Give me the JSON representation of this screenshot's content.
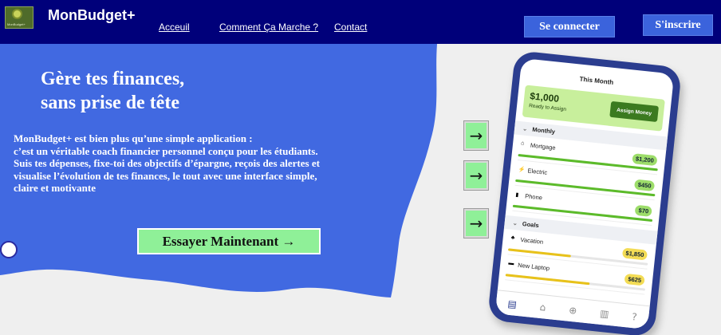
{
  "header": {
    "logo_text": "MonBudget+",
    "brand": "MonBudget+",
    "nav": [
      "Acceuil",
      "Comment Ça Marche ?",
      "Contact"
    ],
    "login_label": "Se connecter",
    "signup_label": "S'inscrire"
  },
  "hero": {
    "title_line1": "Gère tes finances,",
    "title_line2": "sans prise de tête",
    "text": "MonBudget+ est bien plus qu’une simple application :\nc’est un véritable coach financier personnel conçu pour les étudiants.\nSuis tes dépenses, fixe-toi des objectifs d’épargne, reçois des alertes et\n visualise l’évolution de tes finances, le tout avec une interface simple,\nclaire et motivante",
    "cta_label": "Essayer Maintenant →"
  },
  "arrows": [
    "→",
    "→",
    "→"
  ],
  "phone": {
    "header": "This Month",
    "assign_amount": "$1,000",
    "assign_sub": "Ready to Assign",
    "assign_button": "Assign Money",
    "monthly_label": "Monthly",
    "goals_label": "Goals",
    "monthly": [
      {
        "name": "Mortgage",
        "amount": "$1,200",
        "progress": 1.0
      },
      {
        "name": "Electric",
        "amount": "$450",
        "progress": 1.0
      },
      {
        "name": "Phone",
        "amount": "$70",
        "progress": 1.0
      }
    ],
    "goals": [
      {
        "name": "Vacation",
        "amount": "$1,850",
        "progress": 0.45
      },
      {
        "name": "New Laptop",
        "amount": "$625",
        "progress": 0.6
      }
    ]
  },
  "colors": {
    "header_bg": "#00007a",
    "hero_bg": "#4169e1",
    "cta_bg": "#8ff098",
    "phone_frame": "#2b3d8f"
  }
}
